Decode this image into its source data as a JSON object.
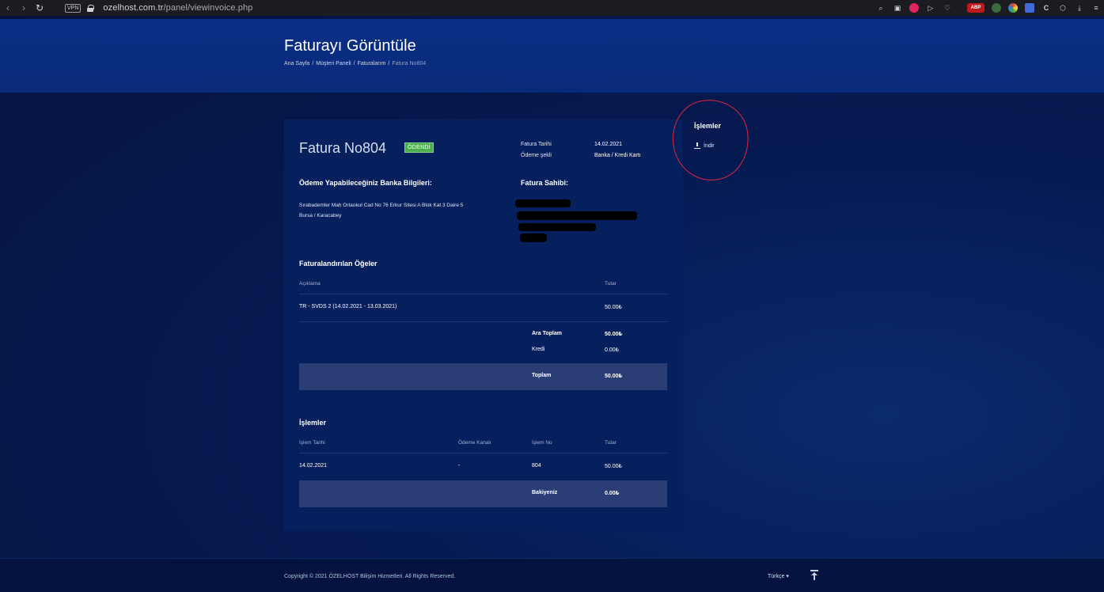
{
  "browser": {
    "vpn_label": "VPN",
    "url_host": "ozelhost.com.tr",
    "url_path": "/panel/viewinvoice.php",
    "ext_abp": "ABP"
  },
  "header": {
    "title": "Faturayı Görüntüle",
    "breadcrumb": [
      "Ana Sayfa",
      "Müşteri Paneli",
      "Faturalarım",
      "Fatura No804"
    ],
    "separator": "/"
  },
  "invoice": {
    "title": "Fatura No804",
    "status": "ÖDENDİ",
    "date_label": "Fatura Tarihi",
    "date_value": "14.02.2021",
    "payment_label": "Ödeme şekli",
    "payment_value": "Banka / Kredi Kartı",
    "bank_heading": "Ödeme Yapabileceğiniz Banka Bilgileri:",
    "address_line1": "Sırabademler Mah Ortaokul Cad No 76 Erkur Sitesi A Blok Kat 3 Daire 5",
    "address_line2": "Bursa / Karacabey",
    "owner_heading": "Fatura Sahibi:",
    "items_heading": "Faturalandırılan Öğeler",
    "items_col_desc": "Açıklama",
    "items_col_amount": "Tutar",
    "items": [
      {
        "desc": "TR - SVDS 2 (14.02.2021 - 13.03.2021)",
        "amount": "50.00₺"
      }
    ],
    "subtotal_label": "Ara Toplam",
    "subtotal_value": "50.00₺",
    "credit_label": "Kredi",
    "credit_value": "0.00₺",
    "total_label": "Toplam",
    "total_value": "50.00₺",
    "tx_heading": "İşlemler",
    "tx_cols": [
      "İşlem Tarihi",
      "Ödeme Kanalı",
      "İşlem No",
      "Tutar"
    ],
    "transactions": [
      {
        "date": "14.02.2021",
        "channel": "-",
        "no": "804",
        "amount": "50.00₺"
      }
    ],
    "balance_label": "Bakiyeniz",
    "balance_value": "0.00₺"
  },
  "side": {
    "title": "İşlemler",
    "download_label": "İndir"
  },
  "footer": {
    "copyright": "Copyright © 2021 ÖZELHOST Bilişim Hizmetleri. All Rights Reserved.",
    "language": "Türkçe ▾"
  }
}
